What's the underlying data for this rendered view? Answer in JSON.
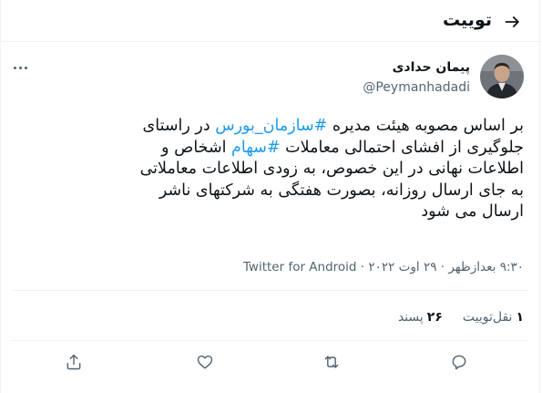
{
  "header": {
    "title": "توییت"
  },
  "author": {
    "name": "پیمان حدادی",
    "handle": "@Peymanhadadi"
  },
  "tweet": {
    "lines": [
      [
        {
          "text": "بر اساس مصوبه هیئت مدیره ",
          "hashtag": false
        },
        {
          "text": "#سازمان_بورس",
          "hashtag": true
        },
        {
          "text": " در راستای",
          "hashtag": false
        }
      ],
      [
        {
          "text": "جلوگیری از افشای احتمالی معاملات ",
          "hashtag": false
        },
        {
          "text": "#سهام",
          "hashtag": true
        },
        {
          "text": " اشخاص و",
          "hashtag": false
        }
      ],
      [
        {
          "text": "اطلاعات نهانی در این خصوص، به زودی اطلاعات معاملاتی",
          "hashtag": false
        }
      ],
      [
        {
          "text": "به جای ارسال روزانه، بصورت هفتگی به شرکتهای ناشر",
          "hashtag": false
        }
      ],
      [
        {
          "text": "ارسال می شود",
          "hashtag": false
        }
      ]
    ]
  },
  "meta": {
    "time": "۹:۳۰ بعدازظهر",
    "date": "۲۹ اوت ۲۰۲۲",
    "separator": " · ",
    "source": "Twitter for Android"
  },
  "stats": {
    "retweets": {
      "count": "۱",
      "label": "نقل‌توییت"
    },
    "likes": {
      "count": "۲۶",
      "label": "پسند"
    }
  },
  "icons": {
    "back": "arrow-right-icon",
    "more": "more-dots-icon",
    "reply": "reply-icon",
    "retweet": "retweet-icon",
    "like": "heart-icon",
    "share": "share-icon"
  },
  "colors": {
    "hashtag": "#1d9bf0",
    "secondary_text": "#536471",
    "divider": "#eff3f4"
  }
}
